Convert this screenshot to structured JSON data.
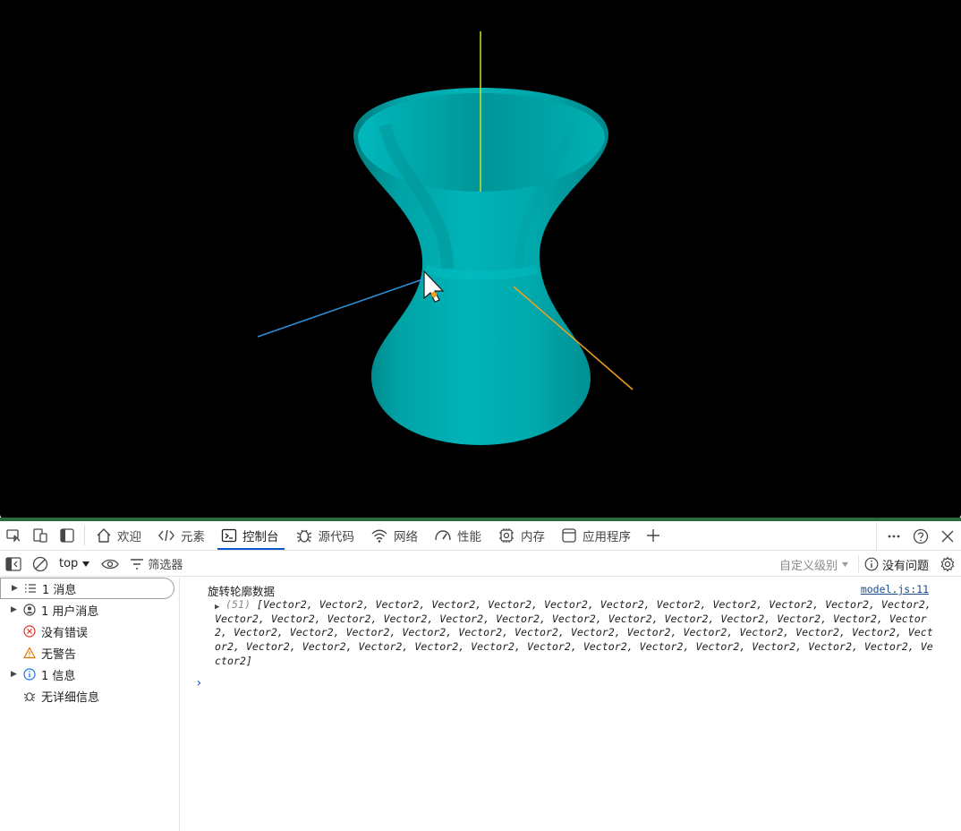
{
  "scene": {
    "background": "#000000",
    "model_color": "#00b0b4",
    "axis_colors": {
      "y": "#c8e61e",
      "x": "#f0a020",
      "z": "#2e8fd8"
    },
    "cursor_icon": "arrow-cursor-icon"
  },
  "devtools": {
    "tabs": [
      {
        "label": "欢迎",
        "icon": "home-icon"
      },
      {
        "label": "元素",
        "icon": "code-icon"
      },
      {
        "label": "控制台",
        "icon": "console-icon",
        "active": true
      },
      {
        "label": "源代码",
        "icon": "bug-icon"
      },
      {
        "label": "网络",
        "icon": "wifi-icon"
      },
      {
        "label": "性能",
        "icon": "gauge-icon"
      },
      {
        "label": "内存",
        "icon": "chip-icon"
      },
      {
        "label": "应用程序",
        "icon": "app-icon"
      }
    ],
    "toolbar": {
      "context": "top",
      "filter_label": "筛选器",
      "level_label": "自定义级别",
      "issues_label": "没有问题"
    },
    "sidebar": [
      {
        "label": "1 消息",
        "icon": "list-icon",
        "expandable": true
      },
      {
        "label": "1 用户消息",
        "icon": "user-icon",
        "expandable": true
      },
      {
        "label": "没有错误",
        "icon": "error-icon",
        "expandable": false
      },
      {
        "label": "无警告",
        "icon": "warning-icon",
        "expandable": false
      },
      {
        "label": "1 信息",
        "icon": "info-icon",
        "expandable": true
      },
      {
        "label": "无详细信息",
        "icon": "verbose-icon",
        "expandable": false
      }
    ],
    "console": {
      "log_text": "旋转轮廓数据",
      "source": "model.js:11",
      "array_count": "(51)",
      "array_body": "[Vector2, Vector2, Vector2, Vector2, Vector2, Vector2, Vector2, Vector2, Vector2, Vector2, Vector2, Vector2, Vector2, Vector2, Vector2, Vector2, Vector2, Vector2, Vector2, Vector2, Vector2, Vector2, Vector2, Vector2, Vector2, Vector2, Vector2, Vector2, Vector2, Vector2, Vector2, Vector2, Vector2, Vector2, Vector2, Vector2, Vector2, Vector2, Vector2, Vector2, Vector2, Vector2, Vector2, Vector2, Vector2, Vector2, Vector2, Vector2, Vector2, Vector2, Vector2]",
      "prompt": "›"
    }
  }
}
